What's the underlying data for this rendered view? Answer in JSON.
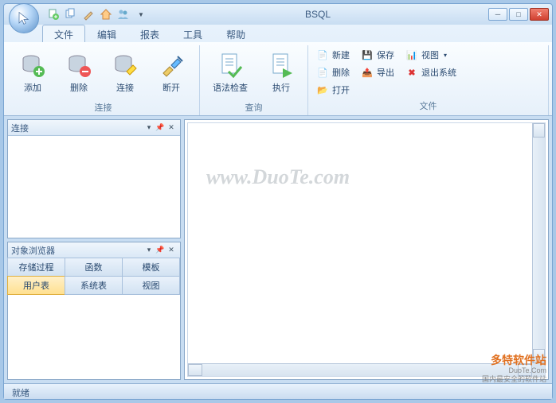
{
  "title": "BSQL",
  "tabs": {
    "file": "文件",
    "edit": "编辑",
    "report": "报表",
    "tool": "工具",
    "help": "帮助"
  },
  "ribbon": {
    "connect_group": "连接",
    "query_group": "查询",
    "file_group": "文件",
    "add": "添加",
    "delete": "删除",
    "connect": "连接",
    "disconnect": "断开",
    "syntax": "语法检查",
    "execute": "执行",
    "new": "新建",
    "del2": "删除",
    "open": "打开",
    "save": "保存",
    "export": "导出",
    "view": "视图",
    "exit": "退出系统"
  },
  "panels": {
    "connect": "连接",
    "browser": "对象浏览器"
  },
  "obj_tabs": {
    "sp": "存储过程",
    "fn": "函数",
    "tmpl": "模板",
    "usertbl": "用户表",
    "systbl": "系统表",
    "view": "视图"
  },
  "status": "就绪",
  "watermark": "www.DuoTe.com",
  "footer": {
    "name": "多特软件站",
    "domain": "DuoTe.Com",
    "slogan": "国内最安全的软件站"
  }
}
